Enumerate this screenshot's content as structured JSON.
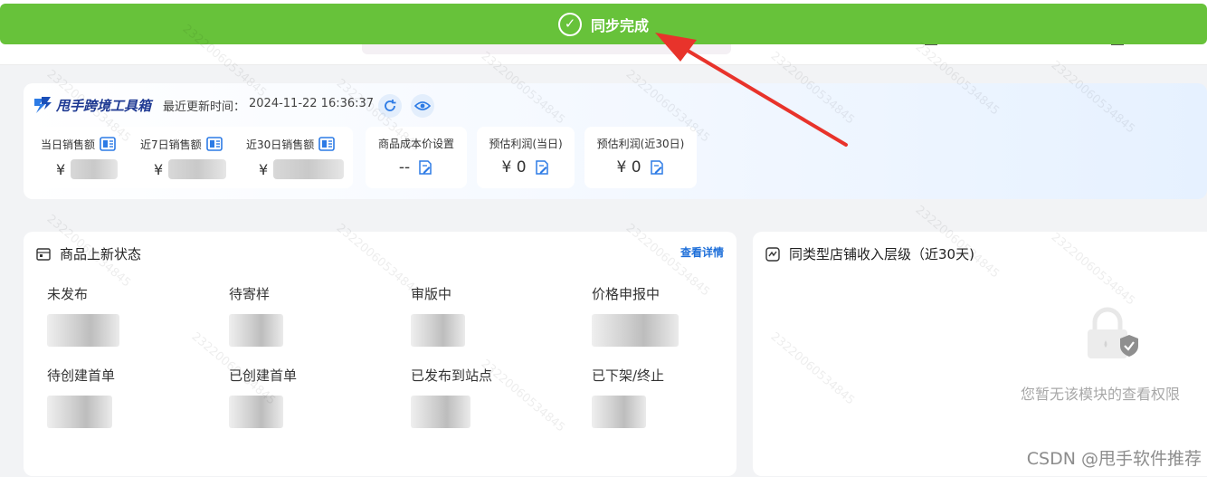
{
  "toast": {
    "message": "同步完成",
    "icon": "check-circle-icon",
    "color": "#67c23a"
  },
  "header": {
    "brand": "甩手跨境工具箱",
    "update_label": "最近更新时间：",
    "update_time": "2024-11-22 16:36:37",
    "refresh_icon": "refresh-icon",
    "visibility_icon": "eye-icon"
  },
  "sales": [
    {
      "label": "当日销售额",
      "currency": "¥"
    },
    {
      "label": "近7日销售额",
      "currency": "¥"
    },
    {
      "label": "近30日销售额",
      "currency": "¥"
    }
  ],
  "cost": {
    "label": "商品成本价设置",
    "value": "--"
  },
  "profit_today": {
    "label": "预估利润(当日)",
    "value": "¥ 0"
  },
  "profit_30": {
    "label": "预估利润(近30日)",
    "value": "¥ 0"
  },
  "product_status": {
    "title": "商品上新状态",
    "detail_link": "查看详情",
    "items": [
      {
        "label": "未发布"
      },
      {
        "label": "待寄样"
      },
      {
        "label": "审版中"
      },
      {
        "label": "价格申报中"
      },
      {
        "label": "待创建首单"
      },
      {
        "label": "已创建首单"
      },
      {
        "label": "已发布到站点"
      },
      {
        "label": "已下架/终止"
      }
    ]
  },
  "income_panel": {
    "title": "同类型店铺收入层级（近30天)",
    "no_permission": "您暂无该模块的查看权限"
  },
  "watermark": "2322006053484​5",
  "footer_watermark": "CSDN @甩手软件推荐",
  "accent_color": "#1e6fd9",
  "arrow_color": "#e8332b"
}
